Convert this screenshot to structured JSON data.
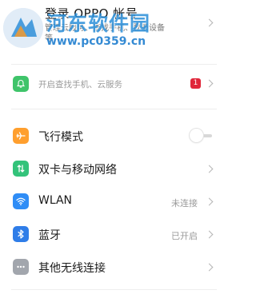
{
  "account": {
    "title": "登录 OPPO 帐号",
    "subtitle": "管理云服务、查找手机、登录设备",
    "subtitle_cont": "等"
  },
  "watermark": {
    "brand": "河东软件园",
    "url": "www.pc0359.cn"
  },
  "find_phone": {
    "label": "开启查找手机、云服务",
    "badge": "1",
    "icon": "bell-icon",
    "color": "#3fc46a"
  },
  "settings": [
    {
      "label": "飞行模式",
      "icon": "airplane-icon",
      "color": "#ff9f2e",
      "toggle": "off"
    },
    {
      "label": "双卡与移动网络",
      "icon": "sim-card-icon",
      "color": "#33c37a"
    },
    {
      "label": "WLAN",
      "value": "未连接",
      "icon": "wifi-icon",
      "color": "#2f8df6"
    },
    {
      "label": "蓝牙",
      "value": "已开启",
      "icon": "bluetooth-icon",
      "color": "#2f7de8"
    },
    {
      "label": "其他无线连接",
      "icon": "more-dots-icon",
      "color": "#a2a6ad"
    }
  ]
}
